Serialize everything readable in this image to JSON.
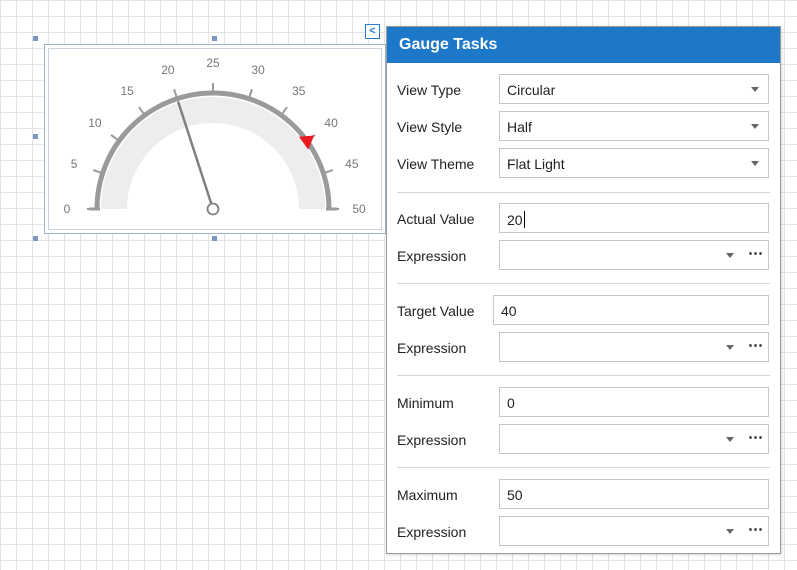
{
  "gauge": {
    "view_type": "Circular",
    "view_style": "Half",
    "scale_min": 0,
    "scale_max": 50,
    "actual_value": 20,
    "target_value": 40,
    "tick_labels": [
      "0",
      "5",
      "10",
      "15",
      "20",
      "25",
      "30",
      "35",
      "40",
      "45",
      "50"
    ],
    "colors": {
      "scale_arc": "#9a9a9a",
      "range_band": "#ededed",
      "needle": "#808080",
      "target_marker": "#e8191f",
      "tick_label": "#777777",
      "selection_handle": "#7b97c0"
    }
  },
  "smart_tag": {
    "icon": "chevron-left-icon",
    "glyph": "<"
  },
  "panel": {
    "title": "Gauge Tasks",
    "accent": "#1d78c9",
    "view_type": {
      "label": "View Type",
      "value": "Circular"
    },
    "view_style": {
      "label": "View Style",
      "value": "Half"
    },
    "view_theme": {
      "label": "View Theme",
      "value": "Flat Light"
    },
    "actual_value": {
      "label": "Actual Value",
      "value": "20",
      "expression_label": "Expression",
      "expression_value": ""
    },
    "target_value": {
      "label": "Target Value",
      "value": "40",
      "expression_label": "Expression",
      "expression_value": ""
    },
    "minimum": {
      "label": "Minimum",
      "value": "0",
      "expression_label": "Expression",
      "expression_value": ""
    },
    "maximum": {
      "label": "Maximum",
      "value": "50",
      "expression_label": "Expression",
      "expression_value": ""
    },
    "ellipsis": "⋯"
  }
}
